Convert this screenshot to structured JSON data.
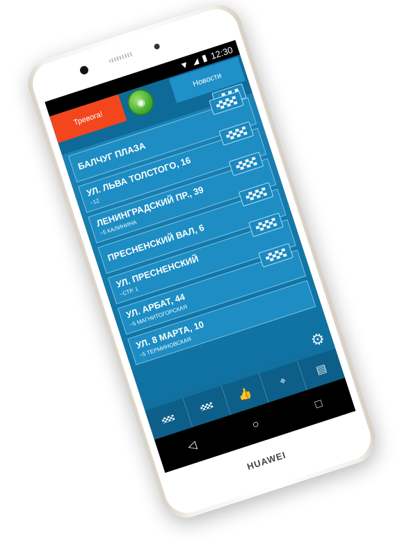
{
  "status": {
    "time": "12:30",
    "signal_icon": "signal-icon",
    "battery_icon": "battery-icon"
  },
  "topbar": {
    "alarm_label": "Тревога!",
    "news_label": "Новости",
    "wifi_icon": "wifi-icon"
  },
  "orders": [
    {
      "address": "БАЛЧУГ ПЛАЗА",
      "sub": ""
    },
    {
      "address": "УЛ. ЛЬВА ТОЛСТОГО, 16",
      "sub": "~12"
    },
    {
      "address": "ЛЕНИНГРАДСКИЙ ПР., 39",
      "sub": "~5 КАЛИНИНА"
    },
    {
      "address": "ПРЕСНЕНСКИЙ ВАЛ, 6",
      "sub": ""
    },
    {
      "address": "УЛ. ПРЕСНЕНСКИЙ",
      "sub": "~СТР. 1"
    },
    {
      "address": "УЛ. АРБАТ, 44",
      "sub": "~5 МАГНИТОГОРСКАЯ"
    },
    {
      "address": "УЛ. 8 МАРТА, 10",
      "sub": "~5 ТЕРМИНОВСКАЯ"
    }
  ],
  "tabs": [
    {
      "icon": "taxi-icon"
    },
    {
      "icon": "taxi-icon"
    },
    {
      "icon": "thumbs-up-icon"
    },
    {
      "icon": "map-icon"
    },
    {
      "icon": "id-card-icon"
    }
  ],
  "settings_icon": "gear-icon",
  "navbar": {
    "back_icon": "back-icon",
    "home_icon": "home-icon",
    "recents_icon": "recents-icon"
  },
  "device_brand": "HUAWEI"
}
